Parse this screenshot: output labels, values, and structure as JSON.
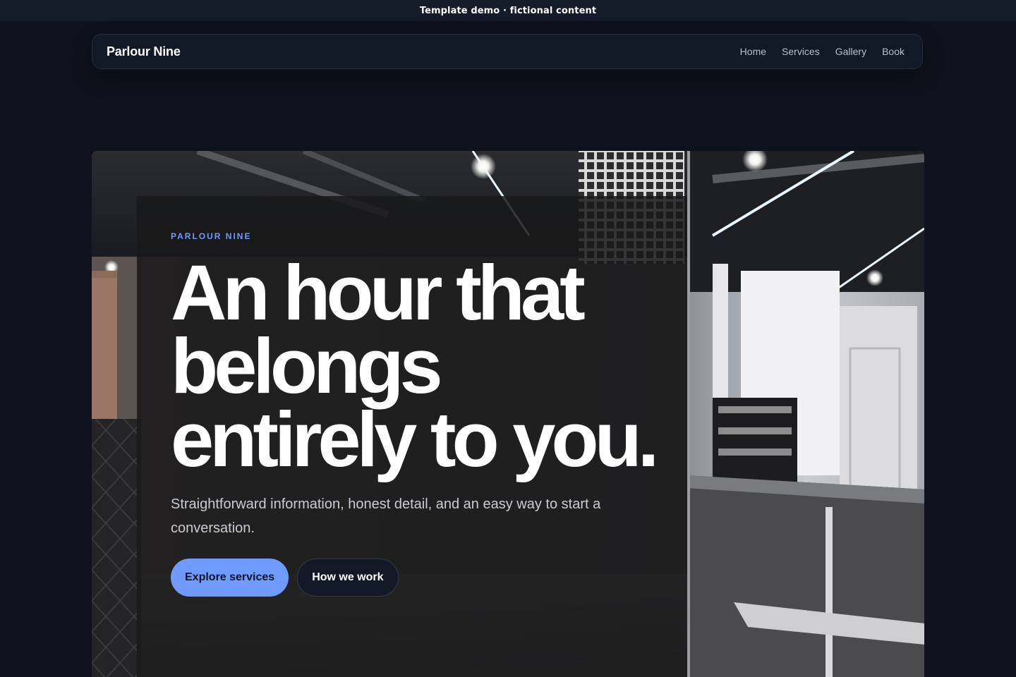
{
  "demo_bar": {
    "text": "Template demo · fictional content"
  },
  "nav": {
    "brand": "Parlour Nine",
    "links": [
      "Home",
      "Services",
      "Gallery",
      "Book"
    ]
  },
  "hero": {
    "eyebrow": "PARLOUR NINE",
    "headline": "An hour that belongs entirely to you.",
    "subtext": "Straightforward information, honest detail, and an easy way to start a conversation.",
    "primary_cta": "Explore services",
    "secondary_cta": "How we work"
  },
  "colors": {
    "accent": "#6f9bff",
    "background": "#0d121c",
    "nav_bg": "#111826"
  }
}
